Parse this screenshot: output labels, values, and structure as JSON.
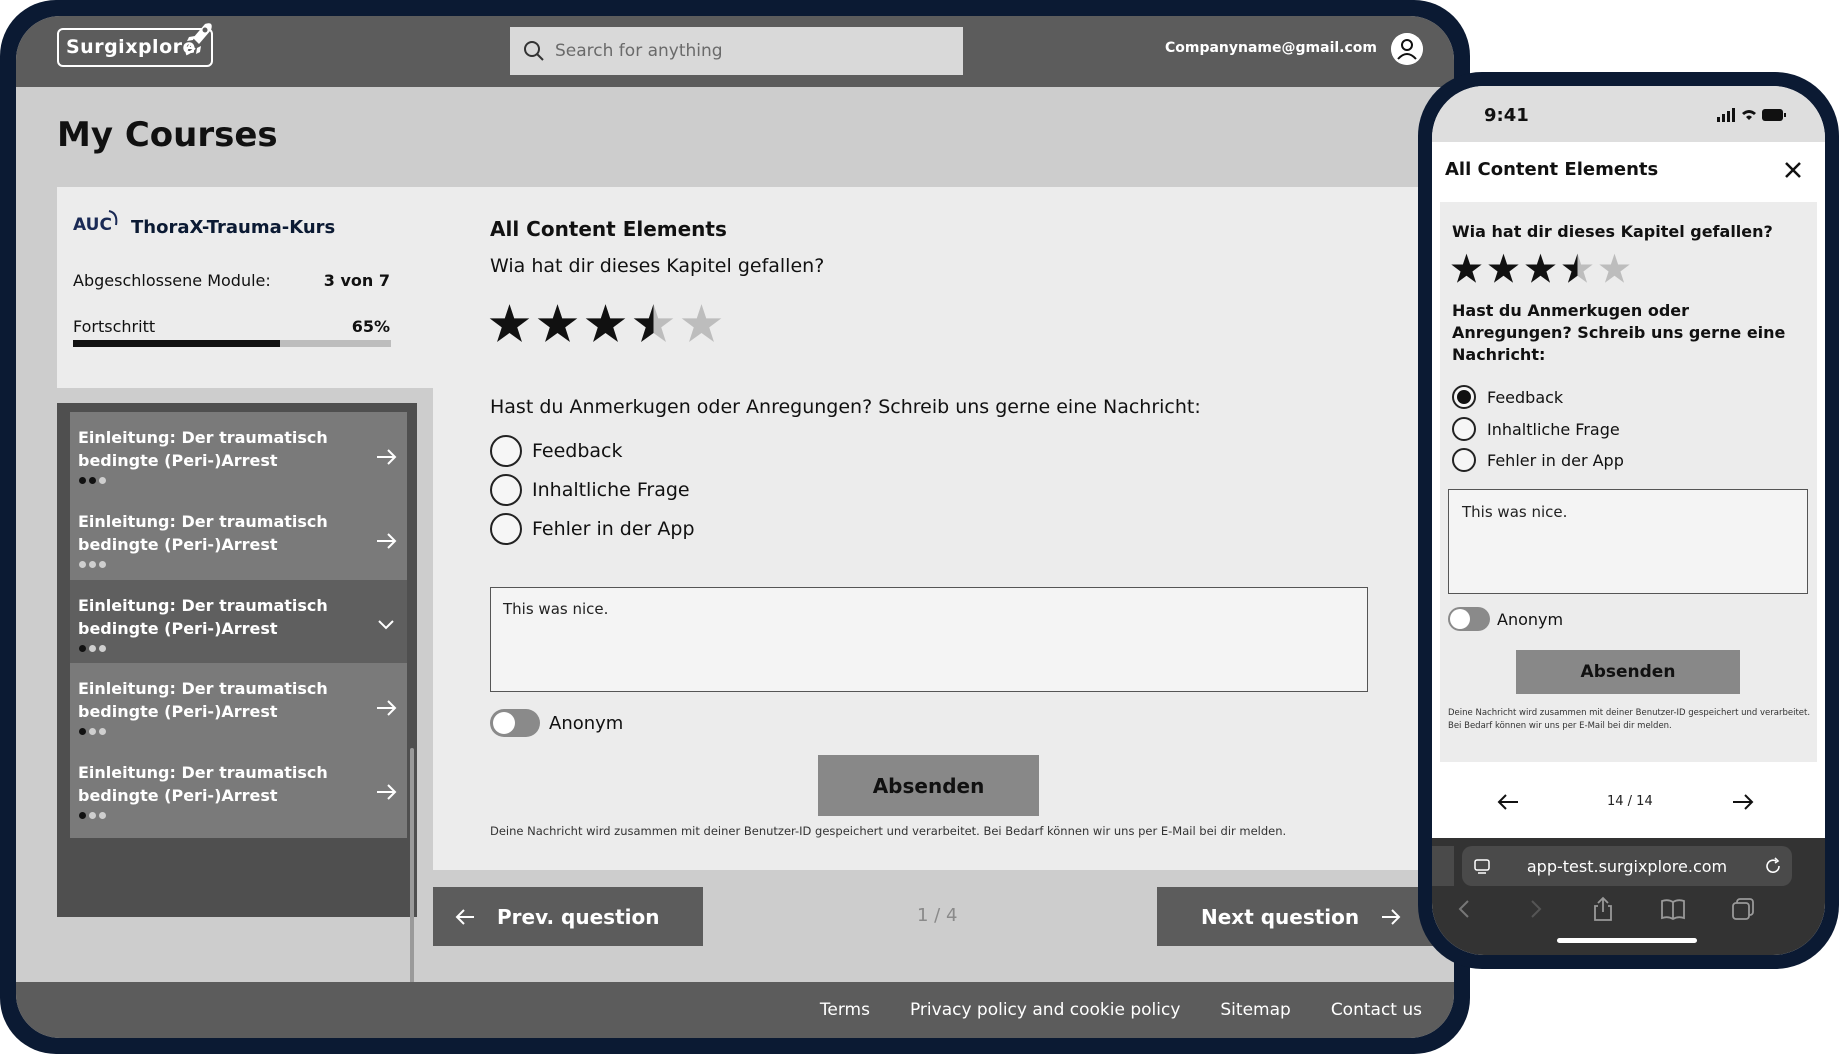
{
  "header": {
    "logo_text": "Surgixplore",
    "search_placeholder": "Search for anything",
    "user_email": "Companyname@gmail.com"
  },
  "page_title": "My Courses",
  "course": {
    "brand": "AUC",
    "name": "ThoraX-Trauma-Kurs",
    "modules_label": "Abgeschlossene Module:",
    "modules_value": "3 von 7",
    "progress_label": "Fortschritt",
    "progress_value": "65%",
    "progress_fraction": 0.65
  },
  "modules": [
    {
      "title": "Einleitung: Der traumatisch bedingte (Peri-)Arrest",
      "dots_done": 2,
      "dots_total": 3,
      "state": "arrow"
    },
    {
      "title": "Einleitung: Der traumatisch bedingte (Peri-)Arrest",
      "dots_done": 0,
      "dots_total": 3,
      "state": "arrow"
    },
    {
      "title": "Einleitung: Der traumatisch bedingte (Peri-)Arrest",
      "dots_done": 1,
      "dots_total": 3,
      "state": "expanded"
    },
    {
      "title": "Einleitung: Der traumatisch bedingte (Peri-)Arrest",
      "dots_done": 1,
      "dots_total": 3,
      "state": "arrow"
    },
    {
      "title": "Einleitung: Der traumatisch bedingte (Peri-)Arrest",
      "dots_done": 1,
      "dots_total": 3,
      "state": "arrow"
    }
  ],
  "content": {
    "heading": "All Content Elements",
    "question": "Wia hat dir dieses Kapitel gefallen?",
    "rating": 3.5,
    "rating_max": 5,
    "prompt": "Hast du Anmerkugen oder Anregungen? Schreib uns gerne eine Nachricht:",
    "options": [
      "Feedback",
      "Inhaltliche Frage",
      "Fehler in der App"
    ],
    "selected_option": null,
    "message": "This was nice.",
    "anonym_label": "Anonym",
    "submit_label": "Absenden",
    "disclaimer": "Deine Nachricht wird zusammen mit deiner Benutzer-ID gespeichert und verarbeitet. Bei Bedarf können wir uns per E-Mail bei dir melden."
  },
  "navigation": {
    "prev_label": "Prev. question",
    "next_label": "Next question",
    "count": "1 / 4"
  },
  "footer": {
    "links": [
      "Terms",
      "Privacy policy and cookie policy",
      "Sitemap",
      "Contact us"
    ]
  },
  "phone": {
    "time": "9:41",
    "title": "All Content Elements",
    "question": "Wia hat dir dieses Kapitel gefallen?",
    "rating": 3.5,
    "prompt": "Hast du Anmerkugen oder Anregungen? Schreib uns gerne eine Nachricht:",
    "options": [
      "Feedback",
      "Inhaltliche Frage",
      "Fehler in der App"
    ],
    "selected_option": "Feedback",
    "message": "This was nice.",
    "anonym_label": "Anonym",
    "submit_label": "Absenden",
    "disclaimer": "Deine Nachricht wird zusammen mit deiner Benutzer-ID gespeichert und verarbeitet. Bei Bedarf können wir uns per E-Mail bei dir melden.",
    "page_count": "14 / 14",
    "url": "app-test.surgixplore.com"
  },
  "colors": {
    "frame": "#0b1a33",
    "header": "#5c5c5c",
    "button": "#888888"
  }
}
